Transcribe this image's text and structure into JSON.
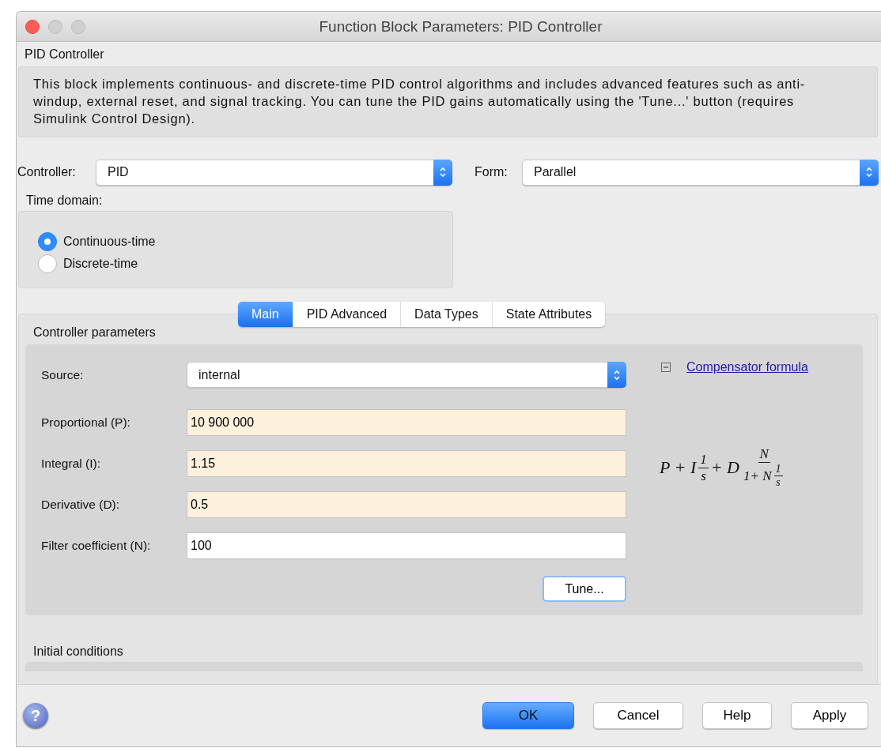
{
  "window": {
    "title": "Function Block Parameters: PID Controller"
  },
  "block": {
    "name": "PID Controller",
    "description": "This block implements continuous- and discrete-time PID control algorithms and includes advanced features such as anti-windup, external reset, and signal tracking. You can tune the PID gains automatically using the 'Tune...' button (requires Simulink Control Design)."
  },
  "controller": {
    "label": "Controller:",
    "value": "PID"
  },
  "form": {
    "label": "Form:",
    "value": "Parallel"
  },
  "time_domain": {
    "label": "Time domain:",
    "options": [
      {
        "label": "Continuous-time",
        "selected": true
      },
      {
        "label": "Discrete-time",
        "selected": false
      }
    ]
  },
  "tabs": [
    {
      "label": "Main",
      "selected": true
    },
    {
      "label": "PID Advanced",
      "selected": false
    },
    {
      "label": "Data Types",
      "selected": false
    },
    {
      "label": "State Attributes",
      "selected": false
    }
  ],
  "controller_parameters": {
    "title": "Controller parameters",
    "fields": [
      {
        "kind": "select",
        "label": "Source:",
        "value": "internal"
      },
      {
        "kind": "tunable",
        "label": "Proportional (P):",
        "value": "10 900 000"
      },
      {
        "kind": "tunable",
        "label": "Integral (I):",
        "value": "1.15"
      },
      {
        "kind": "tunable",
        "label": "Derivative (D):",
        "value": "0.5"
      },
      {
        "kind": "text",
        "label": "Filter coefficient (N):",
        "value": "100"
      }
    ],
    "tune_button": "Tune...",
    "formula_link": {
      "label": "Compensator formula",
      "expanded": true
    },
    "formula": [
      {
        "kind": "text",
        "text": "P + I"
      },
      {
        "kind": "frac",
        "num": [
          {
            "kind": "text",
            "text": "1"
          }
        ],
        "den": [
          {
            "kind": "text",
            "text": "s"
          }
        ]
      },
      {
        "kind": "text",
        "text": "+ D"
      },
      {
        "kind": "frac",
        "num": [
          {
            "kind": "text",
            "text": "N"
          }
        ],
        "den": [
          {
            "kind": "text",
            "text": "1+ N"
          },
          {
            "kind": "frac",
            "num": [
              {
                "kind": "text",
                "text": "1"
              }
            ],
            "den": [
              {
                "kind": "text",
                "text": "s"
              }
            ]
          }
        ]
      }
    ]
  },
  "initial_conditions": {
    "title": "Initial conditions"
  },
  "help_glyph": "?",
  "buttons": [
    {
      "label": "OK",
      "kind": "default"
    },
    {
      "label": "Cancel",
      "kind": "normal"
    },
    {
      "label": "Help",
      "kind": "normal"
    },
    {
      "label": "Apply",
      "kind": "normal"
    }
  ]
}
